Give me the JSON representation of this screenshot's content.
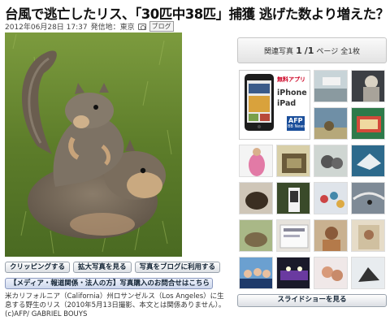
{
  "article": {
    "headline": "台風で逃亡したリス、「30匹中38匹」捕獲 逃げた数より増えた？",
    "date": "2012年06月28日 17:37",
    "dateline": "発信地：東京",
    "blog_label": "ブログ"
  },
  "photo_buttons": {
    "clipping": "クリッピングする",
    "enlarge": "拡大写真を見る",
    "blog_use": "写真をブログに利用する"
  },
  "media_link": "【メディア・報道関係・法人の方】写真購入のお問合せはこちら",
  "caption": "米カリフォルニア（California）州ロサンゼルス（Los Angeles）に生息する野生のリス（2010年5月13日撮影、本文とは関係ありません）。(c)AFP/ GABRIEL BOUYS",
  "sidebar": {
    "title": "関連写真",
    "page_current": "1",
    "page_total": "/1",
    "page_label": "ページ",
    "count": "全1枚",
    "featured_app": {
      "app_label": "無料アプリ",
      "device_1": "iPhone",
      "device_2": "iPad",
      "brand": "AFP",
      "brand_sub": "BB News"
    },
    "slideshow_label": "スライドショーを見る"
  }
}
